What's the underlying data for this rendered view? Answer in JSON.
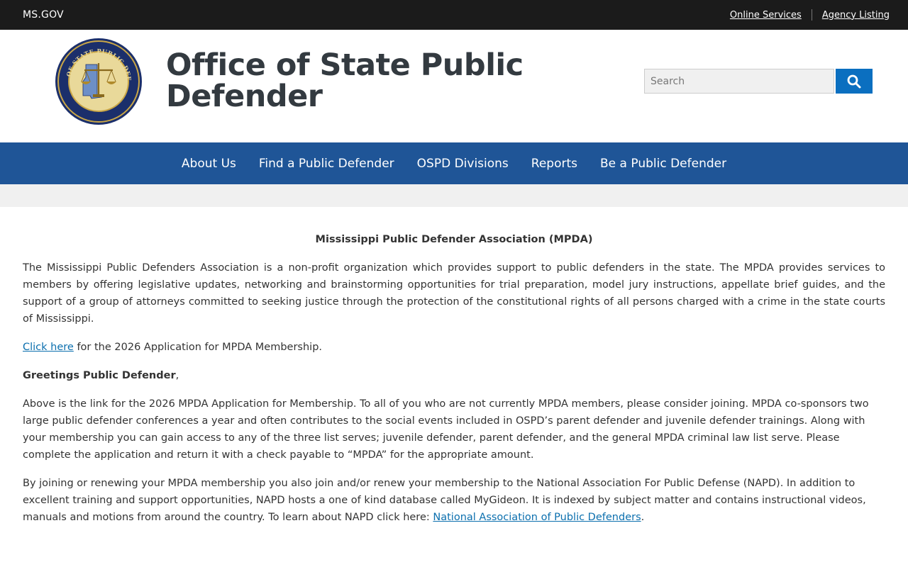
{
  "utility": {
    "site": "MS.GOV",
    "links": [
      "Online Services",
      "Agency Listing"
    ]
  },
  "header": {
    "title": "Office of State Public Defender",
    "seal": {
      "top_text": "OFFICE OF STATE PUBLIC DEFENDER",
      "bottom_text": "MISSISSIPPI"
    }
  },
  "search": {
    "placeholder": "Search"
  },
  "nav": {
    "items": [
      "About Us",
      "Find a Public Defender",
      "OSPD Divisions",
      "Reports",
      "Be a Public Defender"
    ]
  },
  "content": {
    "heading": "Mississippi Public Defender Association (MPDA)",
    "intro": "The Mississippi Public Defenders Association is a non-profit organization which provides support to public defenders in the state. The MPDA provides services to members by offering legislative updates, networking and brainstorming opportunities for trial preparation, model jury instructions, appellate brief guides, and the support of a group of attorneys committed to seeking justice through the protection of the constitutional rights of all persons charged with a crime in the state courts of Mississippi.",
    "application_link": "Click here",
    "application_text": " for the 2026 Application for MPDA Membership.",
    "greeting": "Greetings Public Defender",
    "greeting_suffix": ",",
    "para_membership": "Above is the link for the 2026 MPDA Application for Membership. To all of you who are not currently MPDA members, please consider joining. MPDA co-sponsors two large public defender conferences a year and often contributes to the social events included in OSPD’s parent defender and juvenile defender trainings. Along with your membership you can gain access to any of the three list serves; juvenile defender, parent defender, and the general MPDA criminal law list serve. Please complete the application and return it with a check payable to “MPDA” for the appropriate amount.",
    "para_napd": "By joining or renewing your MPDA membership you also join and/or renew your membership to the National Association For Public Defense (NAPD). In addition to excellent training and support opportunities, NAPD hosts a one of kind database called MyGideon. It is indexed by subject matter and contains instructional videos, manuals and motions from around the country. To learn about NAPD click here: ",
    "napd_link": "National Association of Public Defenders",
    "napd_suffix": "."
  },
  "colors": {
    "utility_bg": "#1b1b1b",
    "nav_bg": "#1f5597",
    "search_button": "#0b6fc0",
    "link": "#0b6fae",
    "seal_navy": "#1b2f6b",
    "seal_gold": "#c9a646"
  },
  "icons": {
    "search": "search-icon",
    "seal": "state-seal-icon"
  }
}
